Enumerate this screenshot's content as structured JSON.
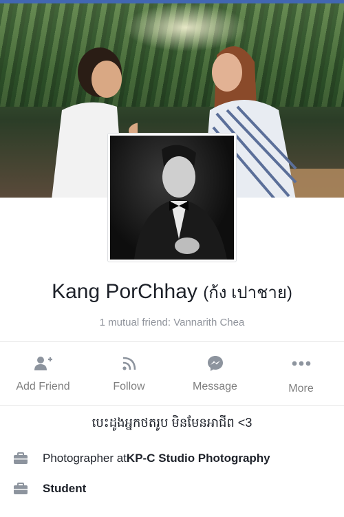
{
  "profile": {
    "name": "Kang PorChhay",
    "native_name": "(ก้ง เปาชาย)",
    "mutual_friends": "1 mutual friend: Vannarith Chea"
  },
  "actions": [
    {
      "label": "Add Friend",
      "icon": "add-friend-icon"
    },
    {
      "label": "Follow",
      "icon": "rss-icon"
    },
    {
      "label": "Message",
      "icon": "messenger-icon"
    },
    {
      "label": "More",
      "icon": "more-dots-icon"
    }
  ],
  "bio": "បេះដូងអ្នកថតរូប មិនមែនអាជីព <3",
  "info": [
    {
      "icon": "briefcase-icon",
      "prefix": "Photographer at ",
      "bold": "KP-C Studio Photography"
    },
    {
      "icon": "briefcase-icon",
      "prefix": "",
      "bold": "Student"
    }
  ],
  "colors": {
    "brand": "#4267b2",
    "icon_gray": "#8d949e",
    "text": "#1d2129",
    "muted": "#90949c"
  }
}
